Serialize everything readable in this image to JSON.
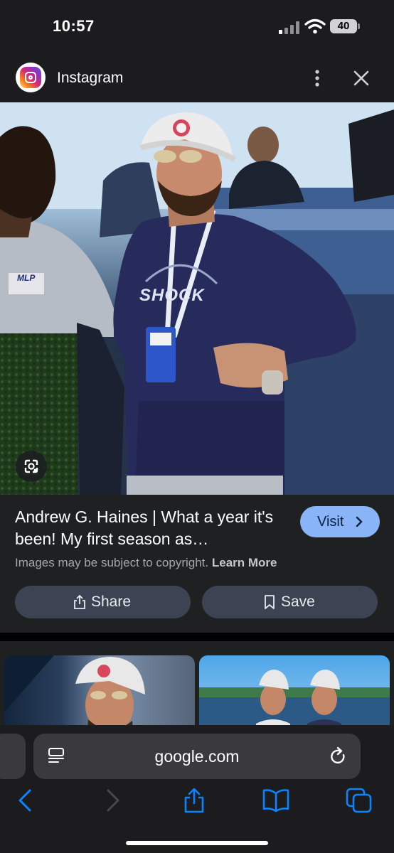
{
  "status_bar": {
    "time": "10:57",
    "battery": "40"
  },
  "top_bar": {
    "app_name": "Instagram"
  },
  "result": {
    "title": "Andrew G. Haines | What a year it's been! My first season as…",
    "visit_label": "Visit",
    "copyright_text": "Images may be subject to copyright.",
    "learn_more": "Learn More",
    "share_label": "Share",
    "save_label": "Save"
  },
  "photo": {
    "shirt_text": "SHOCK",
    "badge_text": "MLP"
  },
  "browser": {
    "url": "google.com"
  },
  "colors": {
    "accent": "#8ab4f8",
    "ios_blue": "#0a84ff",
    "background": "#1f2022"
  }
}
